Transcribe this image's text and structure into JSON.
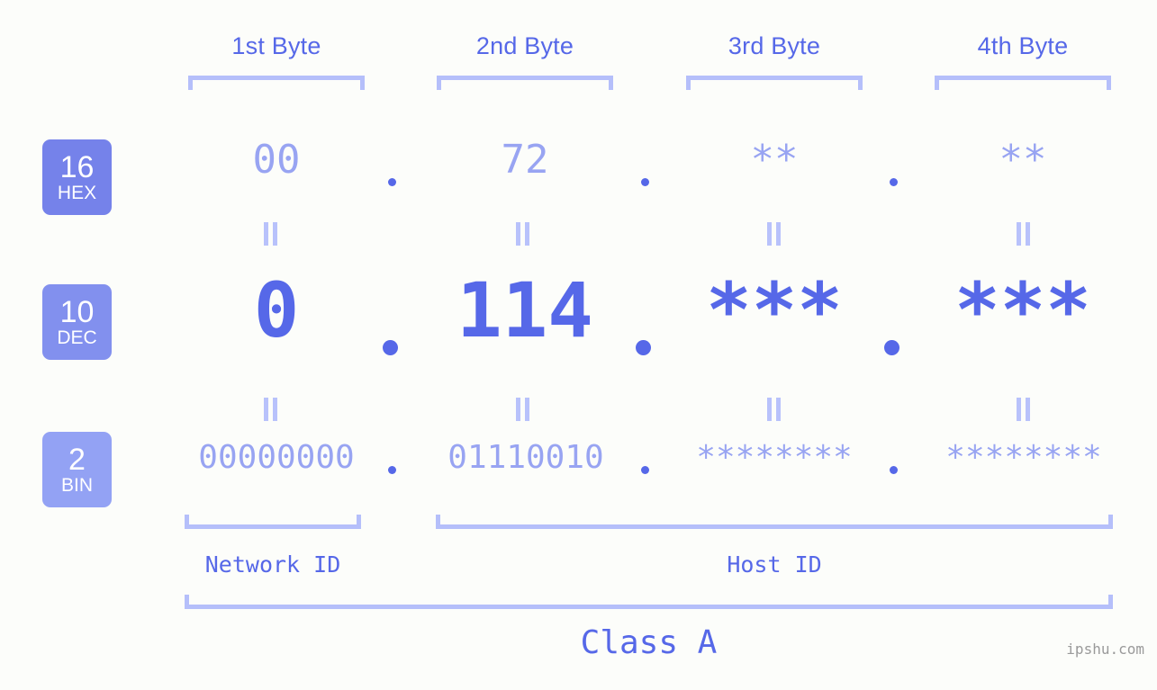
{
  "background_color": "#fcfdfa",
  "accent_color": "#5668e8",
  "muted_color": "#98a4f2",
  "bracket_color": "#b5bffa",
  "headers": {
    "byte1": "1st Byte",
    "byte2": "2nd Byte",
    "byte3": "3rd Byte",
    "byte4": "4th Byte"
  },
  "radix_badges": [
    {
      "number": "16",
      "tag": "HEX",
      "color": "#7582ea"
    },
    {
      "number": "10",
      "tag": "DEC",
      "color": "#8290ee"
    },
    {
      "number": "2",
      "tag": "BIN",
      "color": "#93a2f4"
    }
  ],
  "rows": {
    "hex": {
      "byte1": "00",
      "byte2": "72",
      "byte3": "**",
      "byte4": "**"
    },
    "dec": {
      "byte1": "0",
      "byte2": "114",
      "byte3": "***",
      "byte4": "***"
    },
    "bin": {
      "byte1": "00000000",
      "byte2": "01110010",
      "byte3": "********",
      "byte4": "********"
    }
  },
  "separator": ".",
  "equals_symbol": "=",
  "segments": {
    "network_id": "Network ID",
    "host_id": "Host ID",
    "class": "Class A"
  },
  "watermark": "ipshu.com"
}
